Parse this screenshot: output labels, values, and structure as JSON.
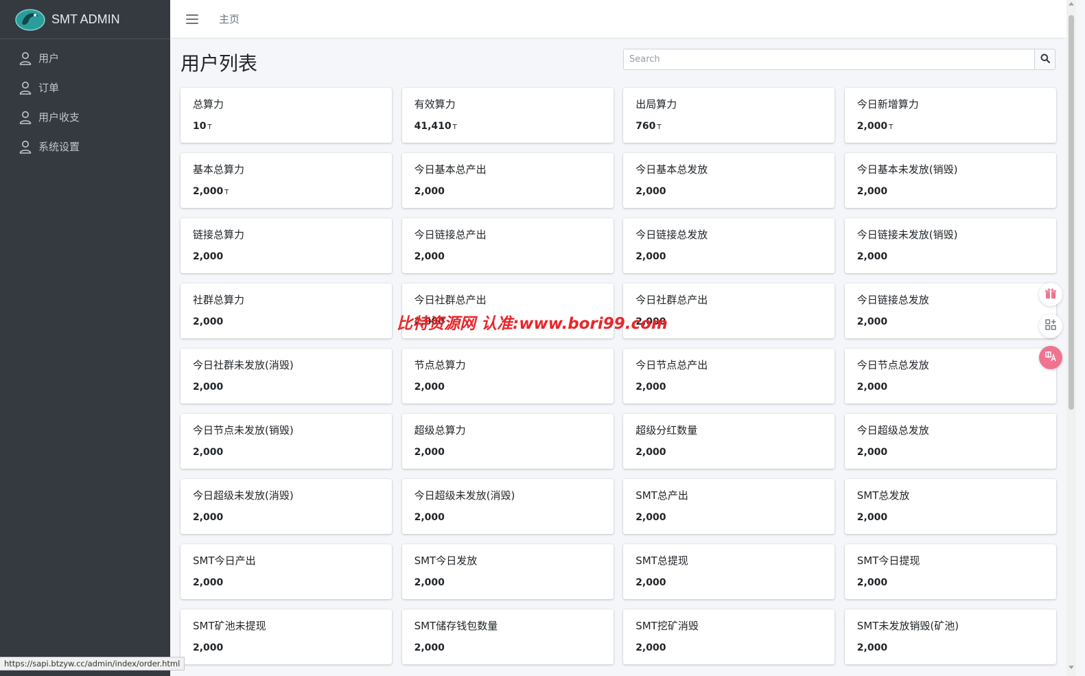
{
  "brand": {
    "name": "SMT ADMIN",
    "logo_icon": "dragon-logo-icon",
    "logo_color": "#2a9d9b"
  },
  "sidebar": {
    "items": [
      {
        "label": "用户",
        "icon": "user-icon"
      },
      {
        "label": "订单",
        "icon": "user-icon"
      },
      {
        "label": "用户收支",
        "icon": "user-icon"
      },
      {
        "label": "系统设置",
        "icon": "user-icon"
      }
    ]
  },
  "topbar": {
    "menu_icon": "hamburger-icon",
    "home_label": "主页"
  },
  "page": {
    "title": "用户列表"
  },
  "search": {
    "placeholder": "Search",
    "value": "",
    "button_icon": "search-icon"
  },
  "stats": [
    {
      "label": "总算力",
      "value": "10",
      "unit": "T"
    },
    {
      "label": "有效算力",
      "value": "41,410",
      "unit": "T"
    },
    {
      "label": "出局算力",
      "value": "760",
      "unit": "T"
    },
    {
      "label": "今日新增算力",
      "value": "2,000",
      "unit": "T"
    },
    {
      "label": "基本总算力",
      "value": "2,000",
      "unit": "T"
    },
    {
      "label": "今日基本总产出",
      "value": "2,000",
      "unit": ""
    },
    {
      "label": "今日基本总发放",
      "value": "2,000",
      "unit": ""
    },
    {
      "label": "今日基本未发放(销毁)",
      "value": "2,000",
      "unit": ""
    },
    {
      "label": "链接总算力",
      "value": "2,000",
      "unit": ""
    },
    {
      "label": "今日链接总产出",
      "value": "2,000",
      "unit": ""
    },
    {
      "label": "今日链接总发放",
      "value": "2,000",
      "unit": ""
    },
    {
      "label": "今日链接未发放(销毁)",
      "value": "2,000",
      "unit": ""
    },
    {
      "label": "社群总算力",
      "value": "2,000",
      "unit": ""
    },
    {
      "label": "今日社群总产出",
      "value": "2,000",
      "unit": ""
    },
    {
      "label": "今日社群总产出",
      "value": "2,000",
      "unit": ""
    },
    {
      "label": "今日链接总发放",
      "value": "2,000",
      "unit": ""
    },
    {
      "label": "今日社群未发放(消毁)",
      "value": "2,000",
      "unit": ""
    },
    {
      "label": "节点总算力",
      "value": "2,000",
      "unit": ""
    },
    {
      "label": "今日节点总产出",
      "value": "2,000",
      "unit": ""
    },
    {
      "label": "今日节点总发放",
      "value": "2,000",
      "unit": ""
    },
    {
      "label": "今日节点未发放(销毁)",
      "value": "2,000",
      "unit": ""
    },
    {
      "label": "超级总算力",
      "value": "2,000",
      "unit": ""
    },
    {
      "label": "超级分红数量",
      "value": "2,000",
      "unit": ""
    },
    {
      "label": "今日超级总发放",
      "value": "2,000",
      "unit": ""
    },
    {
      "label": "今日超级未发放(消毁)",
      "value": "2,000",
      "unit": ""
    },
    {
      "label": "今日超级未发放(消毁)",
      "value": "2,000",
      "unit": ""
    },
    {
      "label": "SMT总产出",
      "value": "2,000",
      "unit": ""
    },
    {
      "label": "SMT总发放",
      "value": "2,000",
      "unit": ""
    },
    {
      "label": "SMT今日产出",
      "value": "2,000",
      "unit": ""
    },
    {
      "label": "SMT今日发放",
      "value": "2,000",
      "unit": ""
    },
    {
      "label": "SMT总提现",
      "value": "2,000",
      "unit": ""
    },
    {
      "label": "SMT今日提现",
      "value": "2,000",
      "unit": ""
    },
    {
      "label": "SMT矿池未提现",
      "value": "2,000",
      "unit": ""
    },
    {
      "label": "SMT储存钱包数量",
      "value": "2,000",
      "unit": ""
    },
    {
      "label": "SMT挖矿消毁",
      "value": "2,000",
      "unit": ""
    },
    {
      "label": "SMT未发放销毁(矿池)",
      "value": "2,000",
      "unit": ""
    }
  ],
  "watermark": {
    "text": "比特资源网 认准:www.bori99.com",
    "color": "#e8272a"
  },
  "float_tools": [
    {
      "icon": "gift-icon",
      "color": "#f0738f"
    },
    {
      "icon": "app-grid-icon",
      "color": "#6c757d"
    },
    {
      "icon": "translate-icon",
      "color": "#f0738f"
    }
  ],
  "statusbar": {
    "url": "https://sapi.btzyw.cc/admin/index/order.html"
  }
}
